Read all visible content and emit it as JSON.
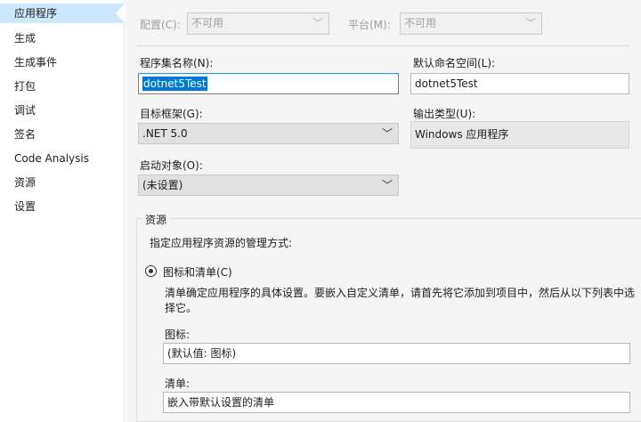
{
  "sidebar": {
    "items": [
      {
        "label": "应用程序"
      },
      {
        "label": "生成"
      },
      {
        "label": "生成事件"
      },
      {
        "label": "打包"
      },
      {
        "label": "调试"
      },
      {
        "label": "签名"
      },
      {
        "label": "Code Analysis"
      },
      {
        "label": "资源"
      },
      {
        "label": "设置"
      }
    ]
  },
  "toolbar": {
    "config_label": "配置(C):",
    "config_value": "不可用",
    "platform_label": "平台(M):",
    "platform_value": "不可用"
  },
  "form": {
    "assembly_label": "程序集名称(N):",
    "assembly_value": "dotnet5Test",
    "namespace_label": "默认命名空间(L):",
    "namespace_value": "dotnet5Test",
    "framework_label": "目标框架(G):",
    "framework_value": ".NET 5.0",
    "output_type_label": "输出类型(U):",
    "output_type_value": "Windows 应用程序",
    "startup_label": "启动对象(O):",
    "startup_value": "(未设置)"
  },
  "resources": {
    "group_title": "资源",
    "desc": "指定应用程序资源的管理方式:",
    "option_label": "图标和清单(C)",
    "option_desc_line1": "清单确定应用程序的具体设置。要嵌入自定义清单，请首先将它添加到项目中，然后从以下列表中选",
    "option_desc_line2": "择它。",
    "icon_label": "图标:",
    "icon_value": "(默认值: 图标)",
    "manifest_label": "清单:",
    "manifest_value": "嵌入带默认设置的清单"
  }
}
